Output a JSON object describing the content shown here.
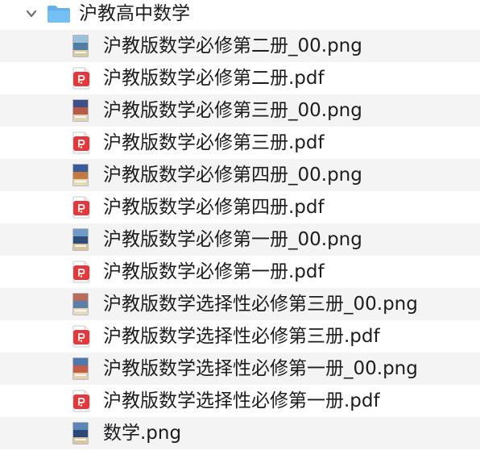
{
  "folder": {
    "name": "沪教高中数学",
    "icon": "folder-icon",
    "expanded": true
  },
  "files": [
    {
      "name": "沪教版数学必修第二册_00.png",
      "type": "png"
    },
    {
      "name": "沪教版数学必修第二册.pdf",
      "type": "pdf"
    },
    {
      "name": "沪教版数学必修第三册_00.png",
      "type": "png"
    },
    {
      "name": "沪教版数学必修第三册.pdf",
      "type": "pdf"
    },
    {
      "name": "沪教版数学必修第四册_00.png",
      "type": "png"
    },
    {
      "name": "沪教版数学必修第四册.pdf",
      "type": "pdf"
    },
    {
      "name": "沪教版数学必修第一册_00.png",
      "type": "png"
    },
    {
      "name": "沪教版数学必修第一册.pdf",
      "type": "pdf"
    },
    {
      "name": "沪教版数学选择性必修第三册_00.png",
      "type": "png"
    },
    {
      "name": "沪教版数学选择性必修第三册.pdf",
      "type": "pdf"
    },
    {
      "name": "沪教版数学选择性必修第一册_00.png",
      "type": "png"
    },
    {
      "name": "沪教版数学选择性必修第一册.pdf",
      "type": "pdf"
    },
    {
      "name": "数学.png",
      "type": "png"
    }
  ],
  "colors": {
    "folder": "#5fb0ec",
    "pdf_red": "#e5383b",
    "alt_row": "#f4f4f5",
    "text": "#1d1d1f"
  }
}
